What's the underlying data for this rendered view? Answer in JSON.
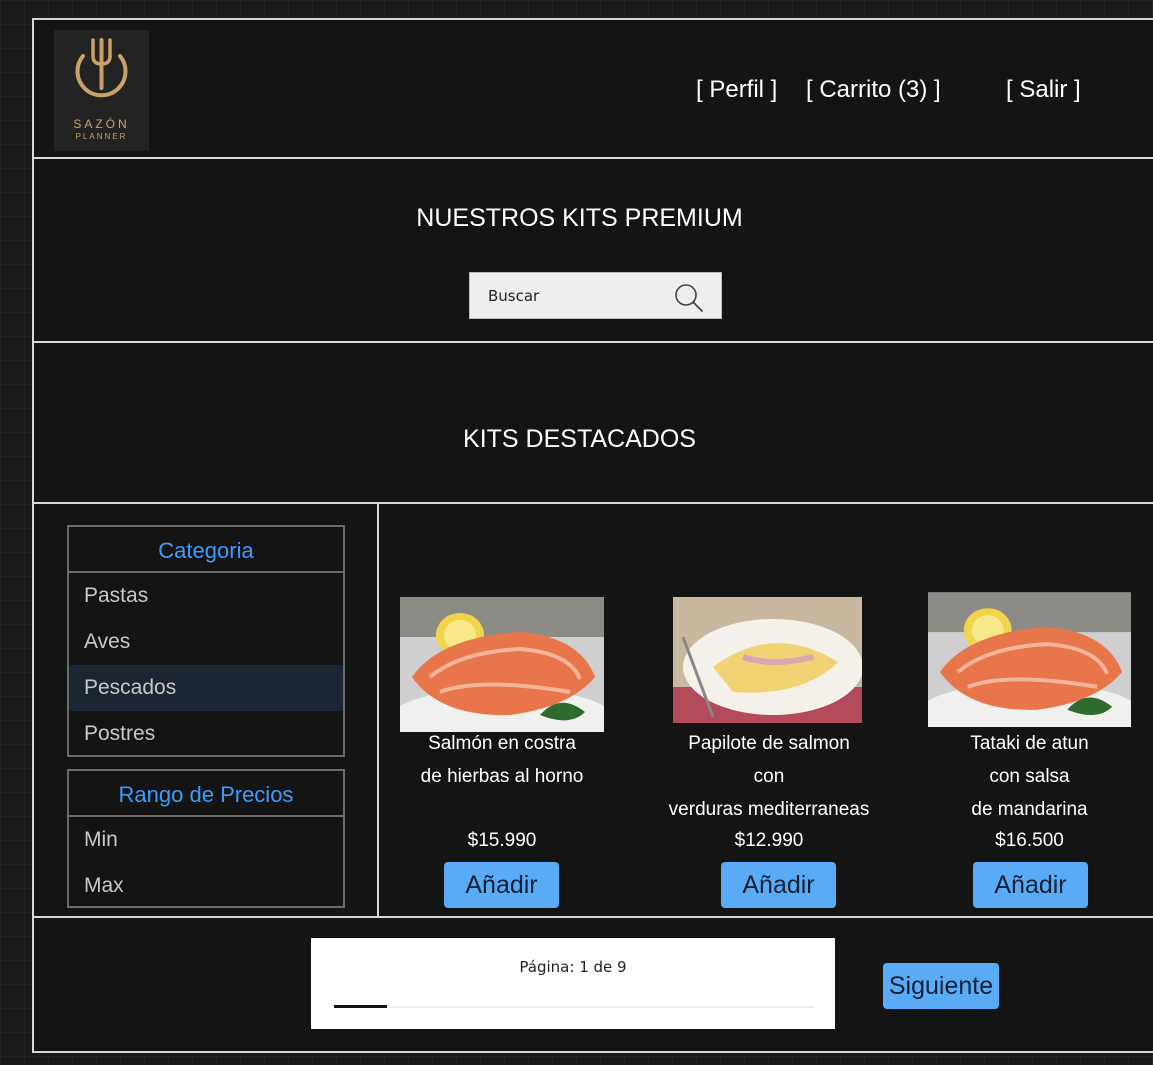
{
  "brand": {
    "name": "SAZÓN",
    "tagline": "PLANNER"
  },
  "nav": {
    "profile": "[ Perfil ]",
    "cart": "[ Carrito (3) ]",
    "logout": "[ Salir ]"
  },
  "hero": {
    "title": "NUESTROS KITS PREMIUM",
    "search_placeholder": "Buscar",
    "search_icon": "search-icon"
  },
  "featured": {
    "title": "KITS DESTACADOS"
  },
  "filters": {
    "category": {
      "title": "Categoria",
      "items": [
        "Pastas",
        "Aves",
        "Pescados",
        "Postres"
      ],
      "selected": "Pescados"
    },
    "price": {
      "title": "Rango de Precios",
      "min_label": "Min",
      "max_label": "Max"
    }
  },
  "products": [
    {
      "name_lines": [
        "Salmón en costra",
        "de hierbas al horno"
      ],
      "price": "$15.990",
      "button": "Añadir",
      "image": "salmon-steak"
    },
    {
      "name_lines": [
        "Papilote de salmon",
        "con",
        "verduras mediterraneas"
      ],
      "price": "$12.990",
      "button": "Añadir",
      "image": "omelette"
    },
    {
      "name_lines": [
        "Tataki de atun",
        "con salsa",
        "de mandarina"
      ],
      "price": "$16.500",
      "button": "Añadir",
      "image": "salmon-steak"
    }
  ],
  "pagination": {
    "label": "Página: 1 de 9",
    "current": 1,
    "total": 9,
    "next": "Siguiente"
  },
  "colors": {
    "accent": "#5aabf5",
    "category_title": "#3d9bff",
    "brand_gold": "#c9a267",
    "background": "#141414"
  }
}
